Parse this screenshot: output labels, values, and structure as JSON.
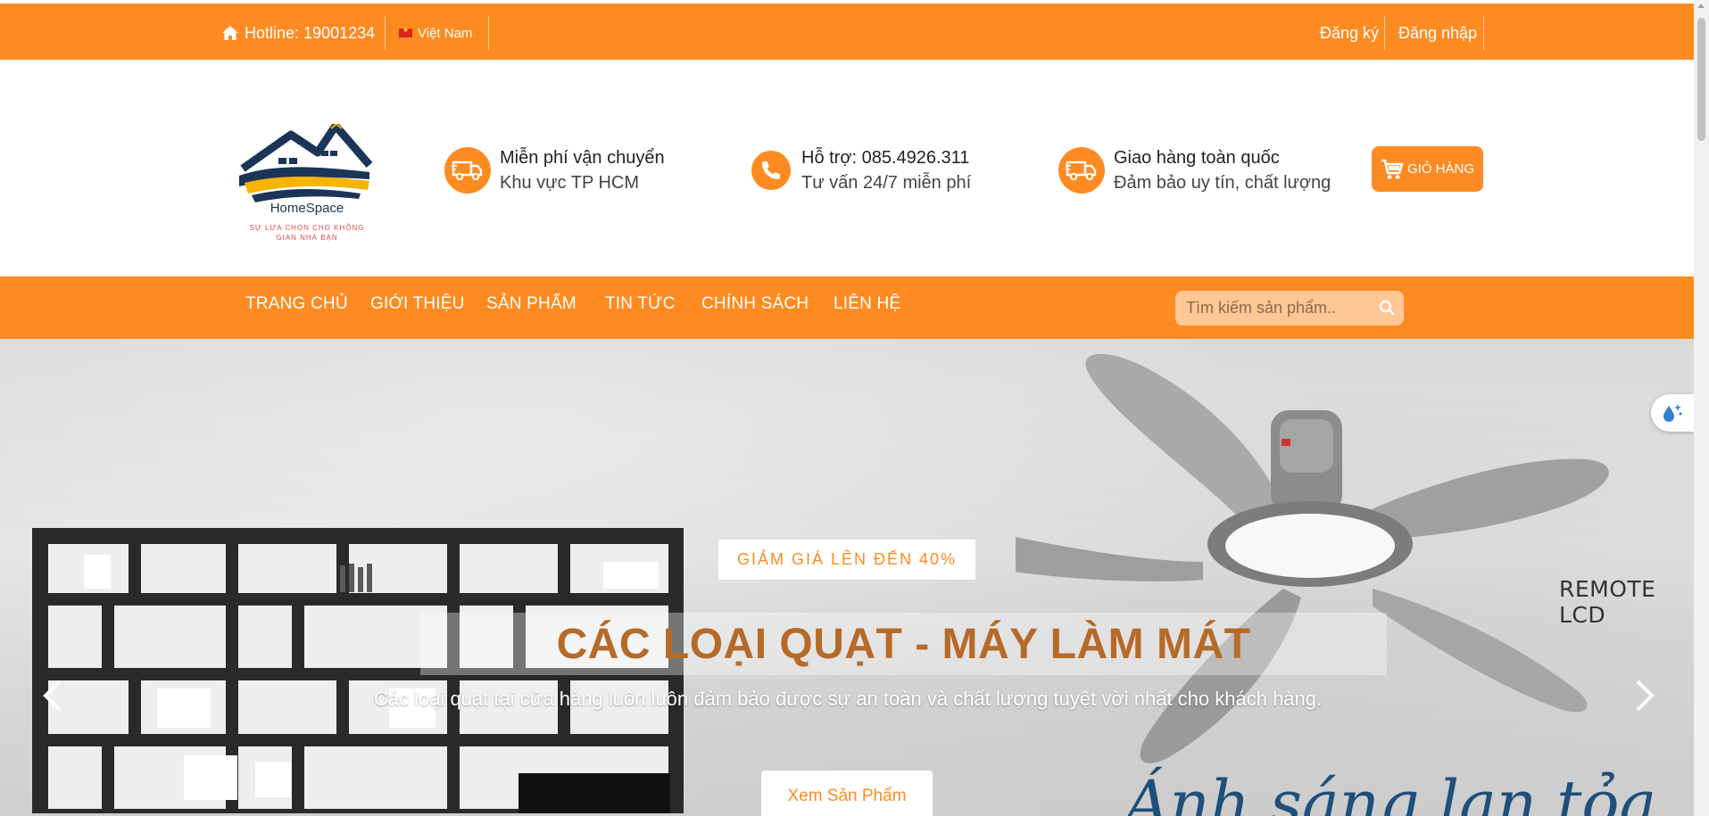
{
  "topbar": {
    "hotline": "Hotline: 19001234",
    "language": "Việt Nam",
    "register": "Đăng ký",
    "login": "Đăng nhập"
  },
  "logo": {
    "brand": "HomeSpace",
    "tagline_line1": "SỰ LỰA CHỌN CHO KHÔNG",
    "tagline_line2": "GIAN NHÀ BẠN"
  },
  "features": [
    {
      "icon": "delivery-truck-icon",
      "title": "Miễn phí vận chuyển",
      "subtitle": "Khu vực TP HCM"
    },
    {
      "icon": "phone-icon",
      "title": "Hỗ trợ: 085.4926.311",
      "subtitle": "Tư vấn 24/7 miễn phí"
    },
    {
      "icon": "delivery-truck-icon",
      "title": "Giao hàng toàn quốc",
      "subtitle": "Đảm bảo uy tín, chất lượng"
    }
  ],
  "cart": {
    "label": "GIỎ HÀNG"
  },
  "nav": {
    "items": [
      "TRANG CHỦ",
      "GIỚI THIỆU",
      "SẢN PHẨM",
      "TIN TỨC",
      "CHÍNH SÁCH",
      "LIÊN HỆ"
    ],
    "search_placeholder": "Tìm kiếm sản phẩm.."
  },
  "hero": {
    "badge": "GIẢM GIÁ LÊN ĐẾN 40%",
    "title": "CÁC LOẠI QUẠT - MÁY LÀM MÁT",
    "description": "Các loại quạt tại cửa hàng luôn luôn đảm bảo được sự an toàn và chất lượng tuyệt vời nhất cho khách hàng.",
    "button": "Xem Sản Phẩm",
    "image_text_remote": "REMOTE LCD",
    "image_text_script": "Ánh sáng lan tỏa"
  },
  "colors": {
    "brand_orange": "#fd8b22",
    "title_brown": "#b56a28"
  }
}
